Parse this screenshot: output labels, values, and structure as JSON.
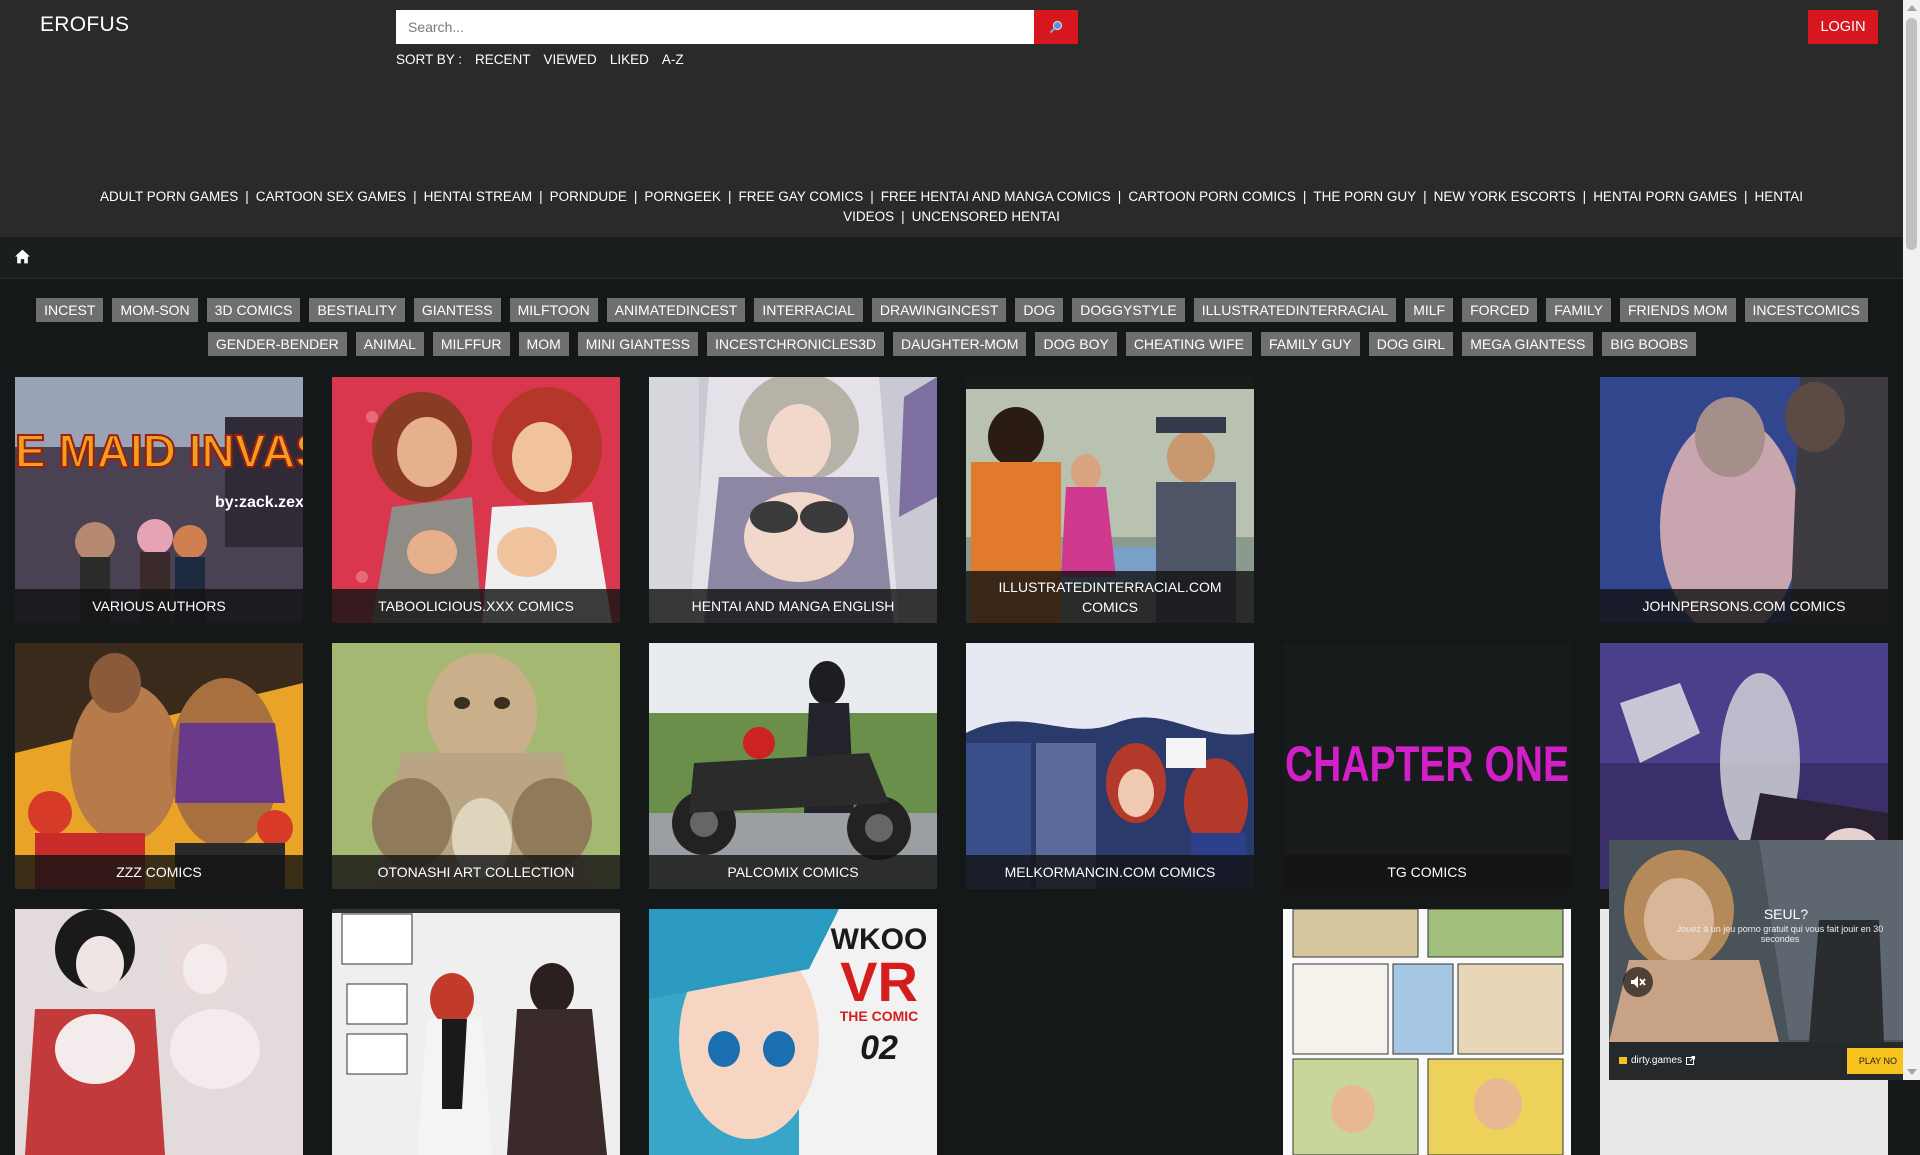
{
  "header": {
    "logo": "EROFUS",
    "search_placeholder": "Search...",
    "sort_label": "SORT BY :",
    "sort_options": [
      "RECENT",
      "VIEWED",
      "LIKED",
      "A-Z"
    ],
    "login": "LOGIN",
    "accent_color": "#d6171f"
  },
  "partner_links": [
    "ADULT PORN GAMES",
    "CARTOON SEX GAMES",
    "HENTAI STREAM",
    "PORNDUDE",
    "PORNGEEK",
    "FREE GAY COMICS",
    "FREE HENTAI AND MANGA COMICS",
    "CARTOON PORN COMICS",
    "THE PORN GUY",
    "NEW YORK ESCORTS",
    "HENTAI PORN GAMES",
    "HENTAI VIDEOS",
    "UNCENSORED HENTAI"
  ],
  "breadcrumb": {
    "icon": "home-icon"
  },
  "tags": [
    "INCEST",
    "MOM-SON",
    "3D COMICS",
    "BESTIALITY",
    "GIANTESS",
    "MILFTOON",
    "ANIMATEDINCEST",
    "INTERRACIAL",
    "DRAWINGINCEST",
    "DOG",
    "DOGGYSTYLE",
    "ILLUSTRATEDINTERRACIAL",
    "MILF",
    "FORCED",
    "FAMILY",
    "FRIENDS MOM",
    "INCESTCOMICS",
    "GENDER-BENDER",
    "ANIMAL",
    "MILFFUR",
    "MOM",
    "MINI GIANTESS",
    "INCESTCHRONICLES3D",
    "DAUGHTER-MOM",
    "DOG BOY",
    "CHEATING WIFE",
    "FAMILY GUY",
    "DOG GIRL",
    "MEGA GIANTESS",
    "BIG BOOBS"
  ],
  "cards": [
    {
      "title": "VARIOUS AUTHORS",
      "art_text": "E MAID INVASION",
      "art_sub": "by:zack.zex"
    },
    {
      "title": "TABOOLICIOUS.XXX COMICS"
    },
    {
      "title": "HENTAI AND MANGA ENGLISH"
    },
    {
      "title": "ILLUSTRATEDINTERRACIAL.COM COMICS"
    },
    {
      "title": "JOHNPERSONS.COM COMICS"
    },
    {
      "title": "ZZZ COMICS"
    },
    {
      "title": "OTONASHI ART COLLECTION"
    },
    {
      "title": "PALCOMIX COMICS"
    },
    {
      "title": "MELKORMANCIN.COM COMICS"
    },
    {
      "title": "TG COMICS",
      "art_text": "CHAPTER ONE"
    },
    {
      "title": ""
    },
    {
      "title": ""
    },
    {
      "title": ""
    },
    {
      "title": "",
      "art_text": "WKOO",
      "art_text2": "VR",
      "art_sub": "THE COMIC",
      "art_num": "02"
    },
    {
      "title": ""
    },
    {
      "title": ""
    }
  ],
  "ad": {
    "title": "SEUL?",
    "subtitle": "Jouez à un jeu porno gratuit qui vous fait jouir en 30 secondes",
    "brand": "dirty.games",
    "cta": "PLAY NO"
  }
}
